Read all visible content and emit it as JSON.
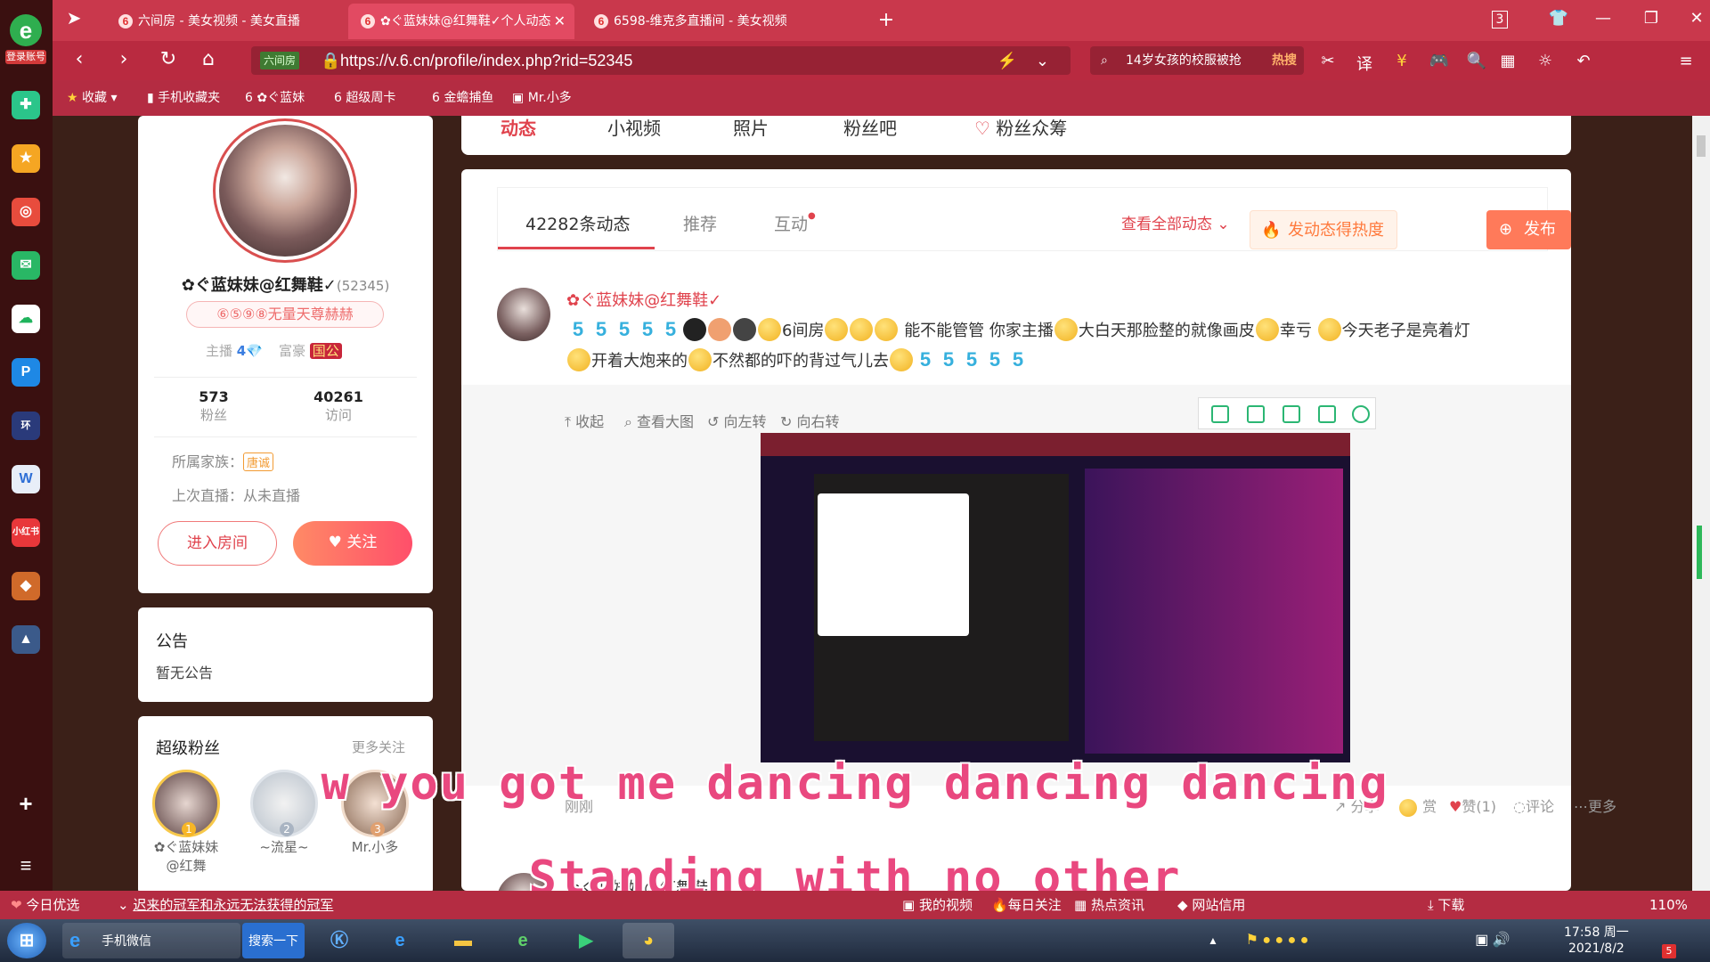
{
  "browser": {
    "logo_text": "e",
    "account_label": "登录账号",
    "tabs": [
      {
        "label": "六间房 - 美女视频 - 美女直播"
      },
      {
        "label": "✿ぐ蓝妹妹@红舞鞋✓个人动态"
      },
      {
        "label": "6598-维克多直播间 - 美女视频"
      }
    ],
    "new_tab": "+",
    "tab_count": "3",
    "address": {
      "badge": "六间房",
      "url": "https://v.6.cn/profile/index.php?rid=52345"
    },
    "search": {
      "text": "14岁女孩的校服被抢",
      "hot": "热搜"
    },
    "bookmarks": [
      {
        "label": "收藏"
      },
      {
        "label": "手机收藏夹"
      },
      {
        "label": "✿ぐ蓝妹"
      },
      {
        "label": "超级周卡"
      },
      {
        "label": "金蟾捕鱼"
      },
      {
        "label": "Mr.小多"
      }
    ]
  },
  "sidebar": {
    "icons": [
      "add-icon",
      "team-icon",
      "star-icon",
      "weibo-icon",
      "mail-icon",
      "cloud-icon",
      "pay-icon",
      "game-icon",
      "doc-icon",
      "xiaohongshu-icon",
      "game2-icon",
      "game3-icon"
    ],
    "add": "+",
    "menu": "≡"
  },
  "topnav": {
    "items": [
      {
        "label": "动态"
      },
      {
        "label": "小视频"
      },
      {
        "label": "照片"
      },
      {
        "label": "粉丝吧"
      },
      {
        "label": "粉丝众筹"
      }
    ]
  },
  "profile": {
    "name": "✿ぐ蓝妹妹@红舞鞋✓",
    "id": "(52345)",
    "badge": "⑥⑤⑨⑧无量天尊赫赫",
    "anchor_label": "主播",
    "anchor_level": "4",
    "rich_label": "富豪",
    "rich_level": "国公",
    "fans_count": "573",
    "fans_label": "粉丝",
    "visits_count": "40261",
    "visits_label": "访问",
    "family_label": "所属家族：",
    "family_tag": "唐诚",
    "last_live": "上次直播：从未直播",
    "enter_room": "进入房间",
    "follow": "关注"
  },
  "notice": {
    "title": "公告",
    "content": "暂无公告"
  },
  "fans": {
    "title": "超级粉丝",
    "more": "更多关注",
    "list": [
      {
        "name": "✿ぐ蓝妹妹@红舞",
        "rank": "1"
      },
      {
        "name": "~流星~",
        "rank": "2"
      },
      {
        "name": "Mr.小多",
        "rank": "3"
      }
    ]
  },
  "feed": {
    "tabs": [
      {
        "label": "42282条动态"
      },
      {
        "label": "推荐"
      },
      {
        "label": "互动"
      }
    ],
    "view_all": "查看全部动态",
    "heat_button": "发动态得热度",
    "publish_button": "发布动态",
    "post": {
      "author": "✿ぐ蓝妹妹@红舞鞋✓",
      "text_a": "6间房",
      "text_b": "能不能管管 你家主播",
      "text_c": "大白天那脸整的就像画皮",
      "text_d": "幸亏",
      "text_e": "今天老子是亮着灯",
      "text_f": "开着大炮来的",
      "text_g": "不然都的吓的背过气儿去",
      "media_tools": {
        "collapse": "收起",
        "view_large": "查看大图",
        "rotate_left": "向左转",
        "rotate_right": "向右转"
      },
      "time": "刚刚",
      "actions": {
        "share": "分享",
        "gift": "赏",
        "like": "赞(1)",
        "comment": "评论",
        "more": "更多"
      }
    },
    "next_author": "✿ぐ蓝妹妹@红舞鞋✓"
  },
  "subtitles": {
    "line1": "w you got me dancing dancing dancing",
    "line2": "Standing with no other"
  },
  "statusbar": {
    "left": "今日优选",
    "news": "迟来的冠军和永远无法获得的冠军",
    "video": "我的视频",
    "follow": "每日关注",
    "hot": "热点资讯",
    "credit": "网站信用",
    "download": "下载",
    "zoom": "110%"
  },
  "taskbar": {
    "app_label": "手机微信",
    "search_btn": "搜索一下",
    "time": "17:58 周一",
    "date": "2021/8/2",
    "notif": "5"
  },
  "colors": {
    "accent": "#e0434d",
    "browser": "#c9384c",
    "orange": "#ff7a3d"
  }
}
